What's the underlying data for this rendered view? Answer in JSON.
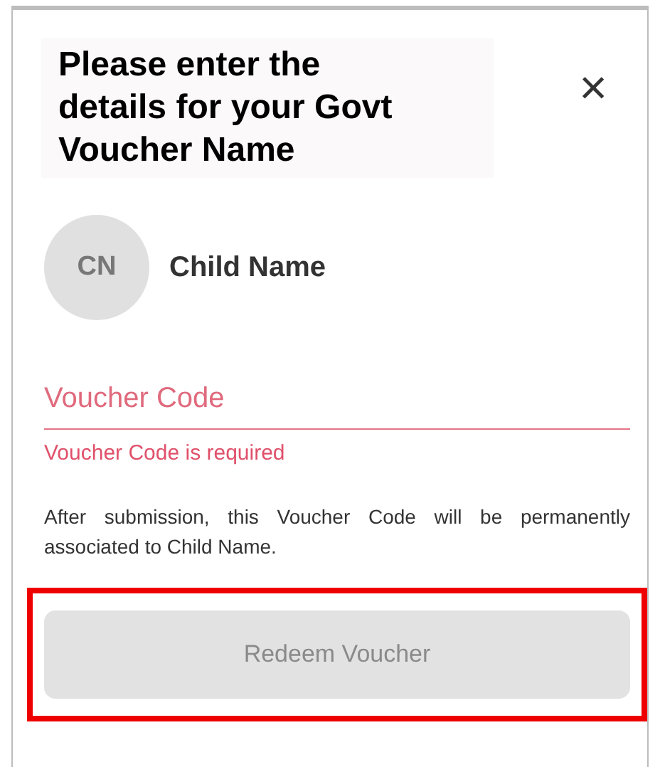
{
  "dialog": {
    "title": "Please enter the details for your Govt Voucher Name",
    "close": "×"
  },
  "child": {
    "initials": "CN",
    "name": "Child Name"
  },
  "voucher_field": {
    "placeholder": "Voucher Code",
    "error": "Voucher Code is required",
    "invalid": true
  },
  "note": "After submission, this Voucher Code will be permanently associated to Child Name.",
  "redeem_button": {
    "label": "Redeem Voucher",
    "disabled": true,
    "highlighted": true
  }
}
